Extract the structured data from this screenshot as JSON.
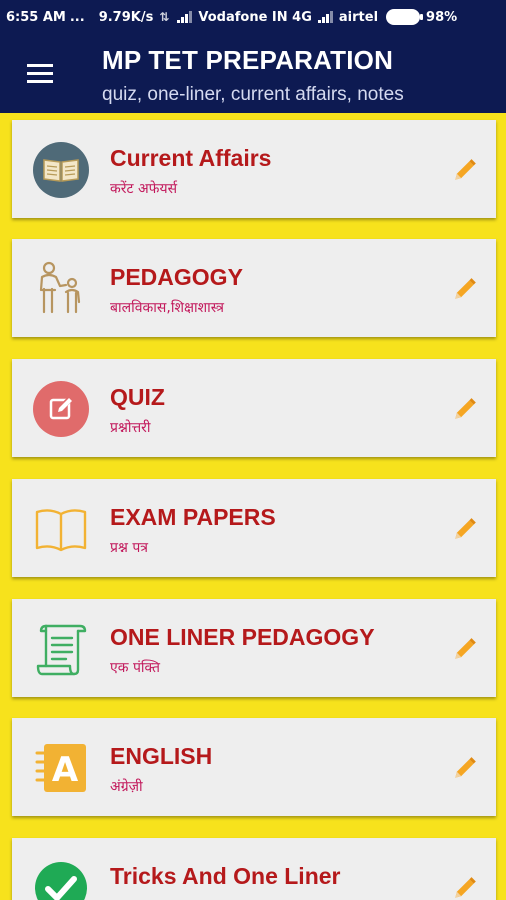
{
  "status_bar": {
    "time": "6:55 AM",
    "dots": "...",
    "speed": "9.79K/s",
    "carrier1": "Vodafone IN 4G",
    "carrier2": "airtel",
    "battery": "98%"
  },
  "app_bar": {
    "title": "MP TET PREPARATION",
    "subtitle": "quiz, one-liner, current affairs, notes"
  },
  "menu": [
    {
      "title": "Current Affairs",
      "subtitle": "करेंट अफेयर्स",
      "icon": "book-circle-icon"
    },
    {
      "title": "PEDAGOGY",
      "subtitle": "बालविकास,शिक्षाशास्त्र",
      "icon": "parent-child-icon"
    },
    {
      "title": "QUIZ",
      "subtitle": "प्रश्नोत्तरी",
      "icon": "quiz-edit-icon"
    },
    {
      "title": "EXAM PAPERS",
      "subtitle": "प्रश्न पत्र",
      "icon": "open-book-icon"
    },
    {
      "title": "ONE LINER PEDAGOGY",
      "subtitle": "एक पंक्ति",
      "icon": "scroll-icon"
    },
    {
      "title": "ENGLISH",
      "subtitle": "अंग्रेज़ी",
      "icon": "english-notebook-icon"
    },
    {
      "title": "Tricks And One Liner",
      "subtitle": "",
      "icon": "checkmark-circle-icon"
    }
  ],
  "colors": {
    "app_bar": "#0d1a52",
    "background": "#f7e21c",
    "card": "#eeeeee",
    "title": "#b5191b",
    "subtitle": "#c2185b",
    "pencil": "#f5a623"
  }
}
